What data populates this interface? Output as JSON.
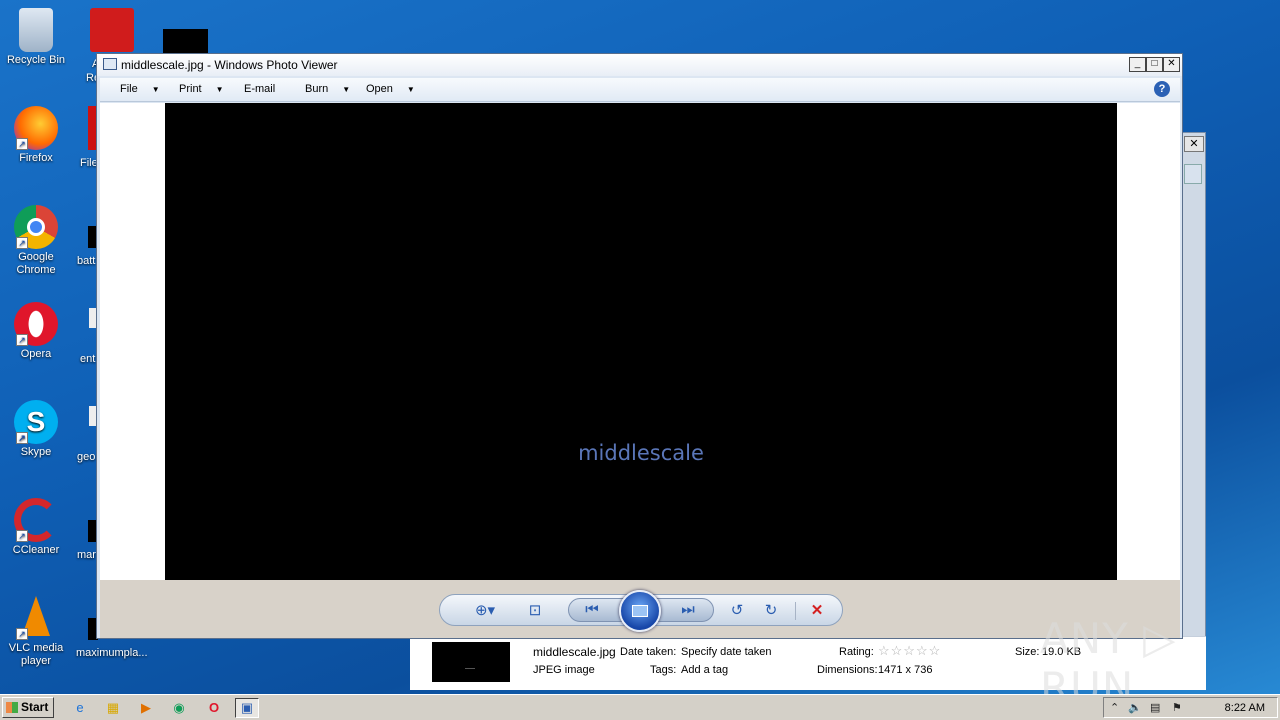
{
  "desktop": {
    "icons": [
      {
        "label": "Recycle Bin",
        "glyph": "🗑"
      },
      {
        "label": "Firefox",
        "glyph": "🦊"
      },
      {
        "label": "Google Chrome",
        "glyph": "◉"
      },
      {
        "label": "Opera",
        "glyph": "O"
      },
      {
        "label": "Skype",
        "glyph": "S"
      },
      {
        "label": "CCleaner",
        "glyph": "C"
      },
      {
        "label": "VLC media player",
        "glyph": "▲"
      }
    ],
    "partial_labels": [
      "A",
      "Re",
      "File",
      "batt",
      "ent",
      "geo",
      "mar",
      "maximumpla..."
    ]
  },
  "viewer": {
    "title": "middlescale.jpg - Windows Photo Viewer",
    "menu": {
      "file": "File",
      "print": "Print",
      "email": "E-mail",
      "burn": "Burn",
      "open": "Open"
    },
    "help_glyph": "?",
    "photo_text": "middlescale",
    "caption": {
      "minimize": "_",
      "maximize": "□",
      "close": "✕"
    },
    "controls": {
      "zoom": "⊕▾",
      "fit": "⊡",
      "prev": "⏮",
      "next": "⏭",
      "rotate_ccw": "↺",
      "rotate_cw": "↻",
      "delete": "✕"
    }
  },
  "details": {
    "filename": "middlescale.jpg",
    "filetype": "JPEG image",
    "date_taken_label": "Date taken:",
    "date_taken_value": "Specify date taken",
    "tags_label": "Tags:",
    "tags_value": "Add a tag",
    "rating_label": "Rating:",
    "rating_stars": "☆☆☆☆☆",
    "dimensions_label": "Dimensions:",
    "dimensions_value": "1471 x 736",
    "size_label": "Size:",
    "size_value": "19.0 KB"
  },
  "taskbar": {
    "start": "Start",
    "clock": "8:22 AM"
  },
  "watermark": "ANY ▷ RUN",
  "colors": {
    "desktop": "#0f5fb5",
    "photo_text": "#5a76b8",
    "delete": "#d42020"
  }
}
